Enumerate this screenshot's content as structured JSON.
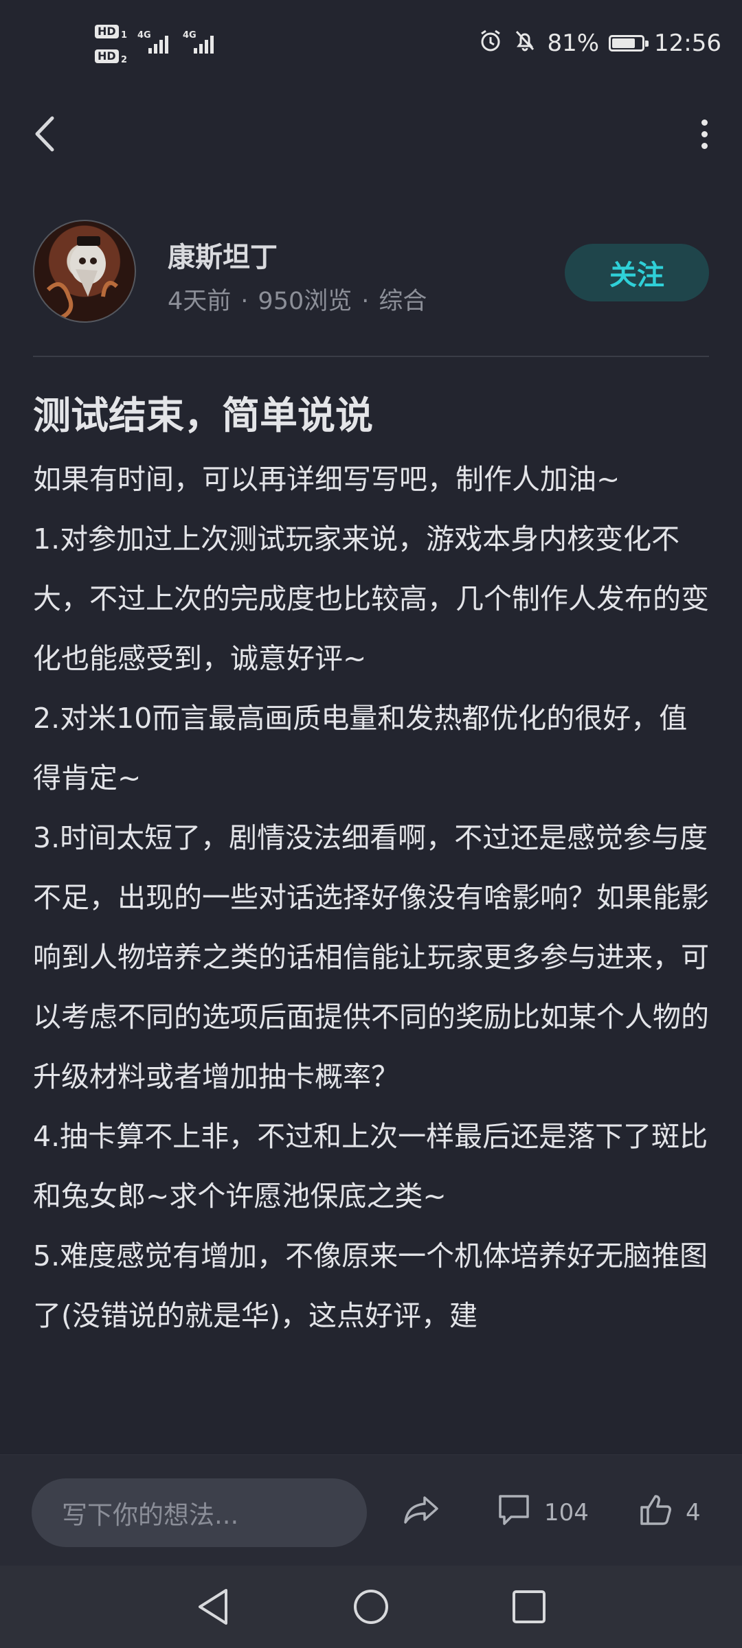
{
  "status_bar": {
    "sim1": "HD",
    "sim1_index": "1",
    "sim2": "HD",
    "sim2_index": "2",
    "network1": "4G",
    "network2": "4G",
    "battery_percent": "81%",
    "battery_level": 0.81,
    "time": "12:56"
  },
  "header": {
    "back_icon": "chevron-left-icon",
    "more_icon": "more-vertical-icon"
  },
  "author": {
    "name": "康斯坦丁",
    "time_ago": "4天前",
    "views": "950浏览",
    "category": "综合",
    "separator": "·",
    "follow_label": "关注"
  },
  "post": {
    "title": "测试结束，简单说说",
    "paragraphs": [
      "如果有时间，可以再详细写写吧，制作人加油~",
      "1.对参加过上次测试玩家来说，游戏本身内核变化不大，不过上次的完成度也比较高，几个制作人发布的变化也能感受到，诚意好评~",
      "2.对米10而言最高画质电量和发热都优化的很好，值得肯定~",
      "3.时间太短了，剧情没法细看啊，不过还是感觉参与度不足，出现的一些对话选择好像没有啥影响？如果能影响到人物培养之类的话相信能让玩家更多参与进来，可以考虑不同的选项后面提供不同的奖励比如某个人物的升级材料或者增加抽卡概率？",
      "4.抽卡算不上非，不过和上次一样最后还是落下了斑比和兔女郎~求个许愿池保底之类~",
      "5.难度感觉有增加，不像原来一个机体培养好无脑推图了(没错说的就是华)，这点好评，建"
    ]
  },
  "bottom_bar": {
    "comment_placeholder": "写下你的想法...",
    "share_icon": "share-icon",
    "comment_icon": "comment-icon",
    "comment_count": "104",
    "like_icon": "thumbs-up-icon",
    "like_count": "4"
  },
  "nav_bar": {
    "back_icon": "nav-back-icon",
    "home_icon": "nav-home-icon",
    "recents_icon": "nav-recents-icon"
  }
}
